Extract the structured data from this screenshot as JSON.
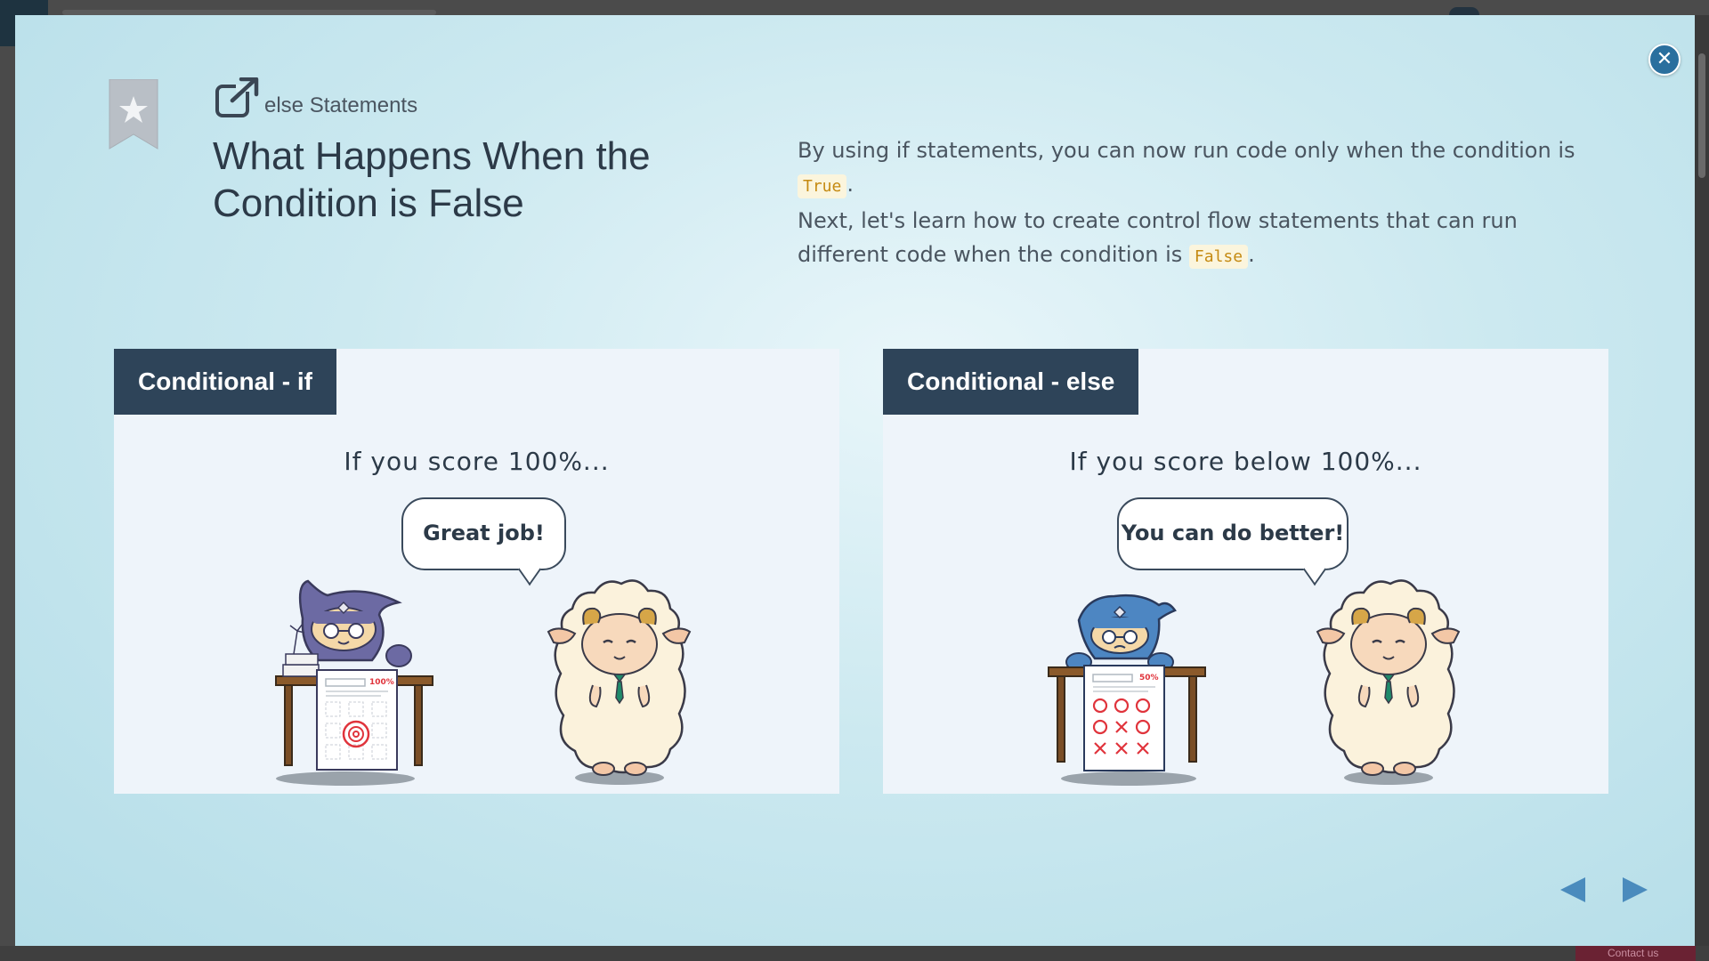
{
  "lesson": {
    "label": "else Statements",
    "title": "What Happens When the Condition is False"
  },
  "intro": {
    "line1_pre": "By using if statements, you can now run code only when the condition is ",
    "line1_code": "True",
    "line1_post": ".",
    "line2_pre": "Next, let's learn how to create control flow statements that can run different code when the condition is ",
    "line2_code": "False",
    "line2_post": "."
  },
  "panels": [
    {
      "tag": "Conditional - if",
      "caption": "If you score 100%...",
      "bubble": "Great job!",
      "paper_score": "100%"
    },
    {
      "tag": "Conditional - else",
      "caption": "If you score below 100%...",
      "bubble": "You can do better!",
      "paper_score": "50%"
    }
  ],
  "background": {
    "contact_label": "Contact us"
  },
  "icons": {
    "close": "close-icon",
    "bookmark": "bookmark-star-icon",
    "external": "external-link-icon",
    "prev": "prev-arrow-icon",
    "next": "next-arrow-icon"
  },
  "colors": {
    "accent": "#2a6f9e",
    "panel_tag": "#2e4459",
    "code_text": "#c58a12",
    "code_bg": "#fbf5dd",
    "nav_arrow": "#4a8bbd"
  }
}
